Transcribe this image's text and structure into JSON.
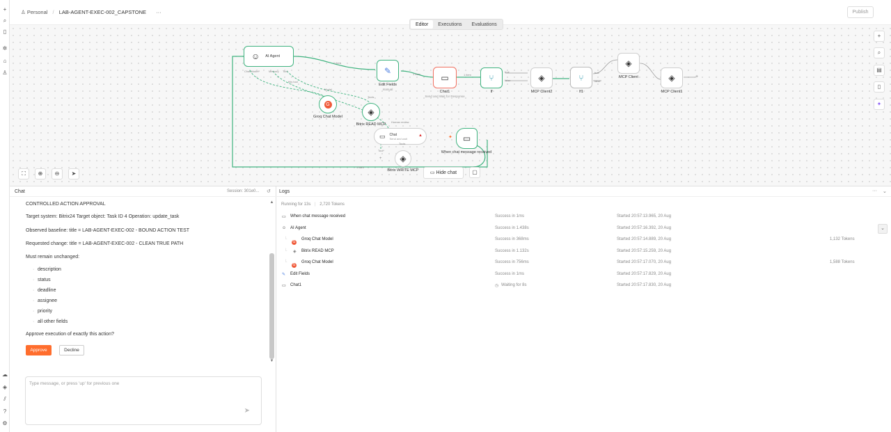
{
  "breadcrumb": {
    "workspace": "Personal",
    "separator": "/",
    "workflow": "LAB-AGENT-EXEC-002_CAPSTONE",
    "menu": "···"
  },
  "publish_label": "Publish",
  "tabs": [
    {
      "label": "Editor",
      "active": true
    },
    {
      "label": "Executions",
      "active": false
    },
    {
      "label": "Evaluations",
      "active": false
    }
  ],
  "nodes": {
    "ai_agent": {
      "label": "AI Agent",
      "ports": [
        "Chat Model*",
        "Memory",
        "Tool"
      ]
    },
    "edit_fields": {
      "label": "Edit Fields",
      "sub": "manual"
    },
    "chat1": {
      "label": "Chat1",
      "sub": "Send and Wait for Response"
    },
    "if": {
      "label": "If",
      "true": "true",
      "false": "false"
    },
    "mcp_client2": {
      "label": "MCP Client2"
    },
    "if1": {
      "label": "If1",
      "true": "true",
      "false": "false"
    },
    "mcp_client": {
      "label": "MCP Client"
    },
    "mcp_client1": {
      "label": "MCP Client1"
    },
    "groq": {
      "label": "Groq Chat Model",
      "port": "Model"
    },
    "bitrix_read": {
      "label": "Bitrix READ MCP",
      "port": "Tools"
    },
    "chat": {
      "label": "Chat",
      "sub": "Send and wait",
      "port": "Tools",
      "badge": "Human review",
      "tool_port": "Tool*"
    },
    "bitrix_write": {
      "label": "Bitrix WRITE MCP"
    },
    "trigger": {
      "label": "When chat message received"
    }
  },
  "edge_labels": {
    "agent_to_edit": "1 item",
    "edit_to_chat1": "1 item",
    "chat1_to_if": "1 item",
    "loop": "1 item",
    "tools": "this tool"
  },
  "hide_chat_label": "Hide chat",
  "chat": {
    "title": "Chat",
    "session": "Session: 301e0...",
    "lines": {
      "heading": "CONTROLLED ACTION APPROVAL",
      "target": "Target system: Bitrix24 Target object: Task ID 4 Operation: update_task",
      "baseline": "Observed baseline: title = LAB-AGENT-EXEC-002 - BOUND ACTION TEST",
      "requested": "Requested change: title = LAB-AGENT-EXEC-002 - CLEAN TRUE PATH",
      "must": "Must remain unchanged:",
      "question": "Approve execution of exactly this action?"
    },
    "unchanged": [
      "description",
      "status",
      "deadline",
      "assignee",
      "priority",
      "all other fields"
    ],
    "approve": "Approve",
    "decline": "Decline",
    "placeholder": "Type message, or press 'up' for previous one"
  },
  "logs": {
    "title": "Logs",
    "running": "Running for 13s",
    "tokens": "2,720 Tokens",
    "menu": "···",
    "rows": [
      {
        "name": "When chat message received",
        "status": "Success in 1ms",
        "started": "Started 20:57:13.965, 20 Aug",
        "tokens": ""
      },
      {
        "name": "AI Agent",
        "status": "Success in 1.438s",
        "started": "Started 20:57:16.392, 20 Aug",
        "tokens": ""
      },
      {
        "name": "Groq Chat Model",
        "status": "Success in 368ms",
        "started": "Started 20:57:14.889, 20 Aug",
        "tokens": "1,132 Tokens"
      },
      {
        "name": "Bitrix READ MCP",
        "status": "Success in 1.132s",
        "started": "Started 20:57:15.259, 20 Aug",
        "tokens": ""
      },
      {
        "name": "Groq Chat Model",
        "status": "Success in 756ms",
        "started": "Started 20:57:17.070, 20 Aug",
        "tokens": "1,588 Tokens"
      },
      {
        "name": "Edit Fields",
        "status": "Success in 1ms",
        "started": "Started 20:57:17.829, 20 Aug",
        "tokens": ""
      },
      {
        "name": "Chat1",
        "status": "Waiting for 8s",
        "started": "Started 20:57:17.830, 20 Aug",
        "tokens": ""
      }
    ]
  },
  "colors": {
    "accent": "#ff6d2d",
    "success": "#3fb37f",
    "error": "#f07060",
    "approve_bg": "#ff6d2d"
  }
}
